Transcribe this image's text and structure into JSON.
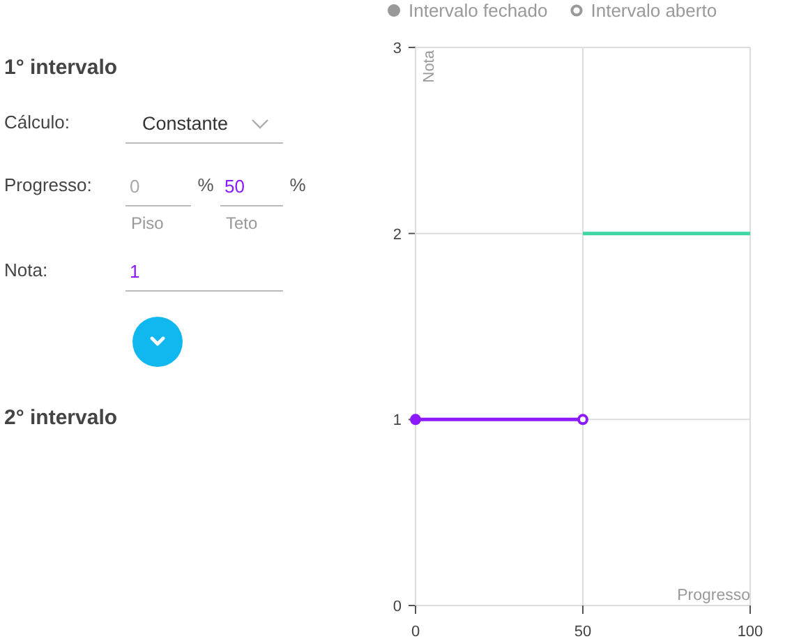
{
  "intervals": [
    {
      "title": "1° intervalo",
      "calc_label": "Cálculo:",
      "calc_value": "Constante",
      "progress_label": "Progresso:",
      "floor": {
        "placeholder": "0",
        "unit": "%",
        "caption": "Piso"
      },
      "ceiling": {
        "value": "50",
        "unit": "%",
        "caption": "Teto"
      },
      "grade_label": "Nota:",
      "grade_value": "1",
      "expanded": false
    },
    {
      "title": "2° intervalo"
    }
  ],
  "legend": [
    {
      "kind": "closed",
      "label": "Intervalo fechado"
    },
    {
      "kind": "open",
      "label": "Intervalo aberto"
    }
  ],
  "chart_data": {
    "type": "line",
    "xlabel": "Progresso",
    "ylabel": "Nota",
    "x": [
      0,
      50,
      100
    ],
    "xlim": [
      0,
      100
    ],
    "ylim": [
      0,
      3
    ],
    "xticks": [
      0,
      50,
      100
    ],
    "yticks": [
      0,
      1,
      2,
      3
    ],
    "grid": true,
    "series": [
      {
        "color": "#8c1aff",
        "marker": "circle",
        "values": [
          1,
          1,
          null
        ]
      },
      {
        "color": "#3dd6a5",
        "values": [
          null,
          2,
          2
        ]
      }
    ]
  }
}
